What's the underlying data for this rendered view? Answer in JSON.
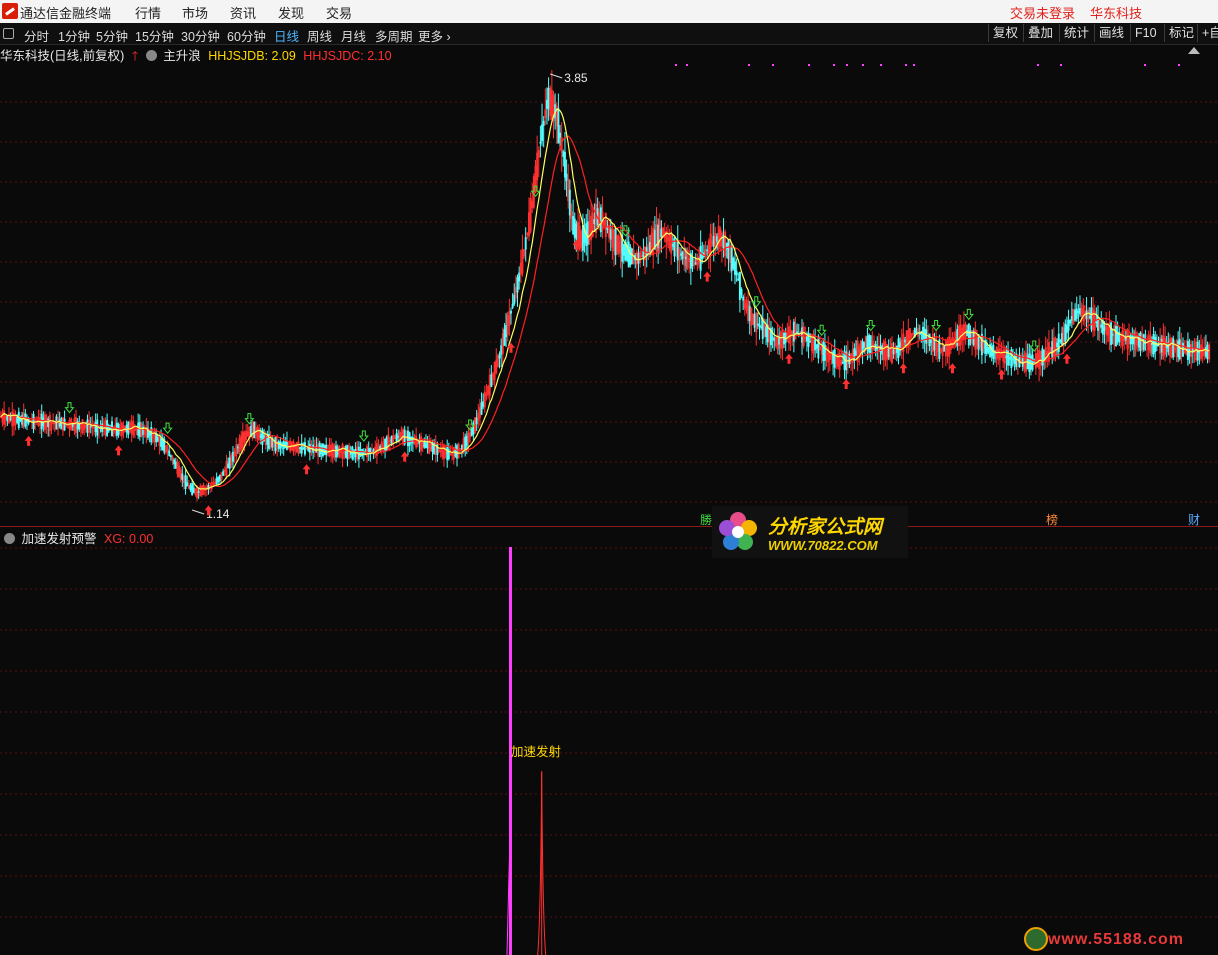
{
  "titlebar": {
    "app_name": "通达信金融终端",
    "menu": [
      "行情",
      "市场",
      "资讯",
      "发现",
      "交易"
    ],
    "login_status": "交易未登录",
    "stock_name": "华东科技"
  },
  "periodbar": {
    "periods": [
      "分时",
      "1分钟",
      "5分钟",
      "15分钟",
      "30分钟",
      "60分钟",
      "日线",
      "周线",
      "月线",
      "多周期",
      "更多 ›"
    ],
    "active": "日线",
    "right_buttons": [
      "复权",
      "叠加",
      "统计",
      "画线",
      "F10",
      "标记",
      "+自"
    ]
  },
  "main_chart": {
    "title": "华东科技(日线,前复权)",
    "indicator_name": "主升浪",
    "hhjsjdb_label": "HHJSJDB: 2.09",
    "hhjsjdc_label": "HHJSJDC: 2.10",
    "max_label": "3.85",
    "min_label": "1.14",
    "bottom_tags": [
      "勝",
      "榜",
      "财"
    ]
  },
  "sub_chart": {
    "title": "加速发射预警",
    "xg_label": "XG: 0.00",
    "signal_text": "加速发射"
  },
  "watermarks": {
    "site1_name": "分析家公式网",
    "site1_url": "WWW.70822.COM",
    "site2_url": "www.55188.com"
  },
  "colors": {
    "up": "#ff3030",
    "down": "#54ffff",
    "ma_fast": "#ffff60",
    "ma_slow": "#ff2020",
    "signal": "#ff40ff",
    "label_yellow": "#ffd700",
    "period_active": "#4fb6ff"
  },
  "chart_data": {
    "type": "candlestick",
    "ohlc_summary": {
      "high": 3.85,
      "low": 1.14
    },
    "series": [
      {
        "name": "HHJSJDB",
        "last": 2.09
      },
      {
        "name": "HHJSJDC",
        "last": 2.1
      }
    ],
    "close_path": [
      1.68,
      1.67,
      1.66,
      1.66,
      1.65,
      1.65,
      1.64,
      1.64,
      1.63,
      1.63,
      1.62,
      1.62,
      1.61,
      1.61,
      1.6,
      1.6,
      1.61,
      1.6,
      1.58,
      1.55,
      1.5,
      1.42,
      1.32,
      1.24,
      1.2,
      1.22,
      1.25,
      1.3,
      1.38,
      1.48,
      1.56,
      1.6,
      1.55,
      1.52,
      1.5,
      1.5,
      1.49,
      1.48,
      1.48,
      1.47,
      1.47,
      1.46,
      1.46,
      1.45,
      1.45,
      1.46,
      1.47,
      1.5,
      1.54,
      1.56,
      1.54,
      1.52,
      1.5,
      1.48,
      1.46,
      1.44,
      1.46,
      1.52,
      1.62,
      1.75,
      1.9,
      2.05,
      2.25,
      2.45,
      2.7,
      3.0,
      3.4,
      3.7,
      3.6,
      3.3,
      2.9,
      2.8,
      2.85,
      2.95,
      2.9,
      2.8,
      2.75,
      2.7,
      2.68,
      2.72,
      2.8,
      2.85,
      2.78,
      2.72,
      2.68,
      2.65,
      2.7,
      2.78,
      2.82,
      2.75,
      2.6,
      2.4,
      2.3,
      2.25,
      2.2,
      2.15,
      2.18,
      2.22,
      2.2,
      2.16,
      2.12,
      2.08,
      2.05,
      2.02,
      2.05,
      2.1,
      2.15,
      2.12,
      2.1,
      2.08,
      2.12,
      2.18,
      2.22,
      2.2,
      2.15,
      2.1,
      2.12,
      2.18,
      2.22,
      2.18,
      2.14,
      2.1,
      2.08,
      2.06,
      2.04,
      2.03,
      2.02,
      2.04,
      2.08,
      2.12,
      2.18,
      2.3,
      2.35,
      2.32,
      2.28,
      2.24,
      2.2,
      2.18,
      2.17,
      2.16,
      2.15,
      2.14,
      2.13,
      2.12,
      2.11,
      2.1,
      2.1,
      2.09
    ],
    "signal_bars": [
      {
        "index": 62,
        "value": 1.0,
        "color": "magenta"
      },
      {
        "index": 66,
        "value": 0.45,
        "color": "red"
      }
    ]
  }
}
